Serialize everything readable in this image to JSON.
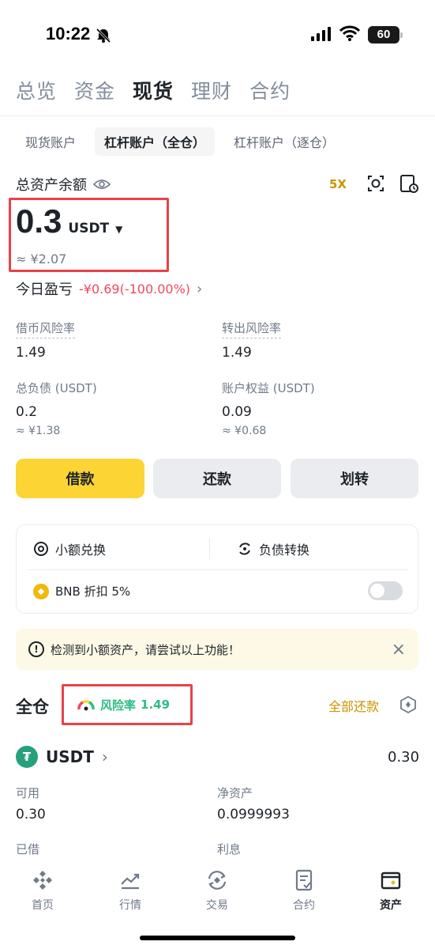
{
  "status": {
    "time": "10:22",
    "battery": "60"
  },
  "top_tabs": [
    "总览",
    "资金",
    "现货",
    "理财",
    "合约"
  ],
  "sub_tabs": [
    "现货账户",
    "杠杆账户（全仓）",
    "杠杆账户（逐仓）"
  ],
  "balance": {
    "label": "总资产余额",
    "leverage": "5X",
    "value": "0.3",
    "unit": "USDT",
    "approx": "≈ ¥2.07"
  },
  "pnl": {
    "label": "今日盈亏",
    "value": "-¥0.69(-100.00%)"
  },
  "stats": {
    "borrow_risk": {
      "label": "借币风险率",
      "value": "1.49"
    },
    "transfer_risk": {
      "label": "转出风险率",
      "value": "1.49"
    },
    "total_debt": {
      "label": "总负债 (USDT)",
      "value": "0.2",
      "approx": "≈ ¥1.38"
    },
    "equity": {
      "label": "账户权益 (USDT)",
      "value": "0.09",
      "approx": "≈ ¥0.68"
    }
  },
  "buttons": {
    "borrow": "借款",
    "repay": "还款",
    "transfer": "划转"
  },
  "tools": {
    "small_convert": "小额兑换",
    "debt_convert": "负债转换",
    "bnb_discount": "BNB 折扣 5%"
  },
  "notice": "检测到小额资产，请尝试以上功能！",
  "section": {
    "title": "全仓",
    "risk_label": "风险率",
    "risk_value": "1.49",
    "repay_all": "全部还款"
  },
  "asset": {
    "symbol": "USDT",
    "total": "0.30",
    "available_label": "可用",
    "available": "0.30",
    "net_label": "净资产",
    "net": "0.0999993",
    "borrowed_label": "已借",
    "interest_label": "利息"
  },
  "nav": [
    "首页",
    "行情",
    "交易",
    "合约",
    "资产"
  ],
  "colors": {
    "accent": "#fcd535",
    "loss": "#f6465d",
    "gain": "#2ebd85",
    "gold": "#c99400"
  }
}
